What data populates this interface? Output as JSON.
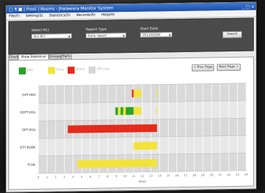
{
  "window": {
    "title": "□ ¶ ■ | Frost | Rooms - Jhalawara Monitor System",
    "controls": "_ □ ×"
  },
  "menu": [
    "File(F)",
    "Setting(S)",
    "Statistics(D)",
    "Records(R)",
    "Help(H)"
  ],
  "filters": {
    "select_label": "Select RCI",
    "select_value": "ALL RCI",
    "report_type_label": "Report Type",
    "report_type_value": "Daily report",
    "start_date_label": "Start Date",
    "start_date_value": "2011/02/04",
    "search_label": "Search"
  },
  "tabs": [
    "Chart",
    "Show Statistical Chart",
    "Groups",
    "Parts"
  ],
  "nav": {
    "prev": "< Prev Page",
    "next": "Next Page >"
  },
  "legend": [
    {
      "label": "Idle",
      "color": "#27a327"
    },
    {
      "label": "Busy",
      "color": "#f2e33a"
    },
    {
      "label": "Alarm",
      "color": "#e62a1a"
    },
    {
      "label": "Off Line",
      "color": "#d6d6d6"
    }
  ],
  "chart_data": {
    "type": "gantt",
    "rows": [
      "DPT-0B4",
      "DEPT-0Gb",
      "DPT-0GA",
      "DTY-BGBK",
      "TCHK"
    ],
    "xlabel": "Hour",
    "x_ticks": [
      "0",
      "1",
      "2",
      "3",
      "4",
      "5",
      "6",
      "7",
      "8",
      "9",
      "10",
      "11",
      "12",
      "13",
      "14",
      "15",
      "16",
      "17",
      "18",
      "19",
      "20",
      "21",
      "22",
      "23",
      "24"
    ],
    "xlim": [
      0,
      24
    ],
    "segments": [
      {
        "row": 0,
        "start": 10.8,
        "end": 11.0,
        "state": "Alarm"
      },
      {
        "row": 0,
        "start": 11.0,
        "end": 11.9,
        "state": "Busy"
      },
      {
        "row": 0,
        "start": 13.6,
        "end": 13.7,
        "state": "Busy"
      },
      {
        "row": 1,
        "start": 8.9,
        "end": 9.2,
        "state": "Idle"
      },
      {
        "row": 1,
        "start": 9.2,
        "end": 9.5,
        "state": "Busy"
      },
      {
        "row": 1,
        "start": 9.5,
        "end": 9.8,
        "state": "Idle"
      },
      {
        "row": 1,
        "start": 9.8,
        "end": 10.1,
        "state": "Busy"
      },
      {
        "row": 1,
        "start": 10.1,
        "end": 11.0,
        "state": "Idle"
      },
      {
        "row": 1,
        "start": 11.0,
        "end": 11.9,
        "state": "Busy"
      },
      {
        "row": 1,
        "start": 13.6,
        "end": 13.7,
        "state": "Busy"
      },
      {
        "row": 2,
        "start": 3.4,
        "end": 13.7,
        "state": "Alarm"
      },
      {
        "row": 3,
        "start": 11.0,
        "end": 13.7,
        "state": "Busy"
      },
      {
        "row": 4,
        "start": 4.5,
        "end": 13.7,
        "state": "Busy"
      }
    ],
    "grid": true
  }
}
